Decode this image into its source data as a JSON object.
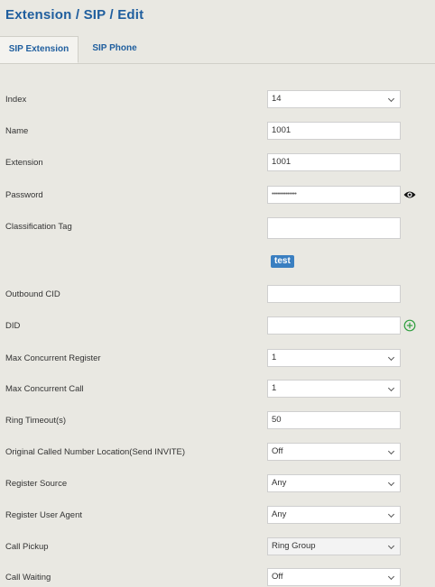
{
  "page": {
    "title": "Extension / SIP / Edit"
  },
  "tabs": [
    {
      "label": "SIP Extension"
    },
    {
      "label": "SIP Phone"
    }
  ],
  "fields": {
    "index": {
      "label": "Index",
      "value": "14"
    },
    "name": {
      "label": "Name",
      "value": "1001"
    },
    "extension": {
      "label": "Extension",
      "value": "1001"
    },
    "password": {
      "label": "Password",
      "value": "••••••••••••••"
    },
    "classification_tag": {
      "label": "Classification Tag",
      "value": "",
      "tag": "test"
    },
    "outbound_cid": {
      "label": "Outbound CID",
      "value": ""
    },
    "did": {
      "label": "DID",
      "value": ""
    },
    "max_concurrent_register": {
      "label": "Max Concurrent Register",
      "value": "1"
    },
    "max_concurrent_call": {
      "label": "Max Concurrent Call",
      "value": "1"
    },
    "ring_timeout": {
      "label": "Ring Timeout(s)",
      "value": "50"
    },
    "original_called_number_location": {
      "label": "Original Called Number Location(Send INVITE)",
      "value": "Off"
    },
    "register_source": {
      "label": "Register Source",
      "value": "Any"
    },
    "register_user_agent": {
      "label": "Register User Agent",
      "value": "Any"
    },
    "call_pickup": {
      "label": "Call Pickup",
      "value": "Ring Group"
    },
    "call_waiting": {
      "label": "Call Waiting",
      "value": "Off"
    }
  },
  "icons": {
    "password_toggle": "eye-icon",
    "did_add": "plus-circle-icon",
    "select_arrow": "chevron-down-icon"
  },
  "colors": {
    "title": "#1f5e9e",
    "tag_background": "#3a7fc1",
    "add_icon": "#2e9e3e",
    "background": "#e9e8e2"
  }
}
